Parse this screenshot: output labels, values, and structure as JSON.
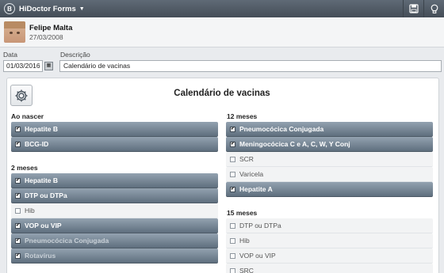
{
  "app": {
    "title": "HiDoctor Forms",
    "logo_letter": "B"
  },
  "patient": {
    "name": "Felipe Malta",
    "dob": "27/03/2008"
  },
  "form": {
    "date_label": "Data",
    "date_value": "01/03/2016",
    "desc_label": "Descrição",
    "desc_value": "Calendário de vacinas"
  },
  "card": {
    "title": "Calendário de vacinas"
  },
  "sections": {
    "ao_nascer": {
      "title": "Ao nascer",
      "items": [
        {
          "label": "Hepatite B",
          "checked": true
        },
        {
          "label": "BCG-ID",
          "checked": true
        }
      ]
    },
    "dois_meses": {
      "title": "2 meses",
      "items": [
        {
          "label": "Hepatite B",
          "checked": true
        },
        {
          "label": "DTP ou DTPa",
          "checked": true
        },
        {
          "label": "Hib",
          "checked": false
        },
        {
          "label": "VOP ou VIP",
          "checked": true
        },
        {
          "label": "Pneumocócica Conjugada",
          "checked": true
        },
        {
          "label": "Rotavírus",
          "checked": true
        }
      ]
    },
    "doze_meses": {
      "title": "12 meses",
      "items": [
        {
          "label": "Pneumocócica Conjugada",
          "checked": true
        },
        {
          "label": "Meningocócica C e A, C, W, Y Conj",
          "checked": true
        },
        {
          "label": "SCR",
          "checked": false
        },
        {
          "label": "Varicela",
          "checked": false
        },
        {
          "label": "Hepatite A",
          "checked": true
        }
      ]
    },
    "quinze_meses": {
      "title": "15 meses",
      "items": [
        {
          "label": "DTP ou DTPa",
          "checked": false
        },
        {
          "label": "Hib",
          "checked": false
        },
        {
          "label": "VOP ou VIP",
          "checked": false
        },
        {
          "label": "SRC",
          "checked": false
        }
      ]
    }
  },
  "icons": {
    "logo": "app-logo-icon",
    "toolbar_1": "save-icon",
    "toolbar_2": "lightbulb-icon",
    "calendar": "calendar-icon",
    "settings": "gear-icon"
  },
  "colors": {
    "topbar": "#4f5964",
    "checked_row": "#7a8998",
    "unchecked_row": "#f2f3f4"
  }
}
